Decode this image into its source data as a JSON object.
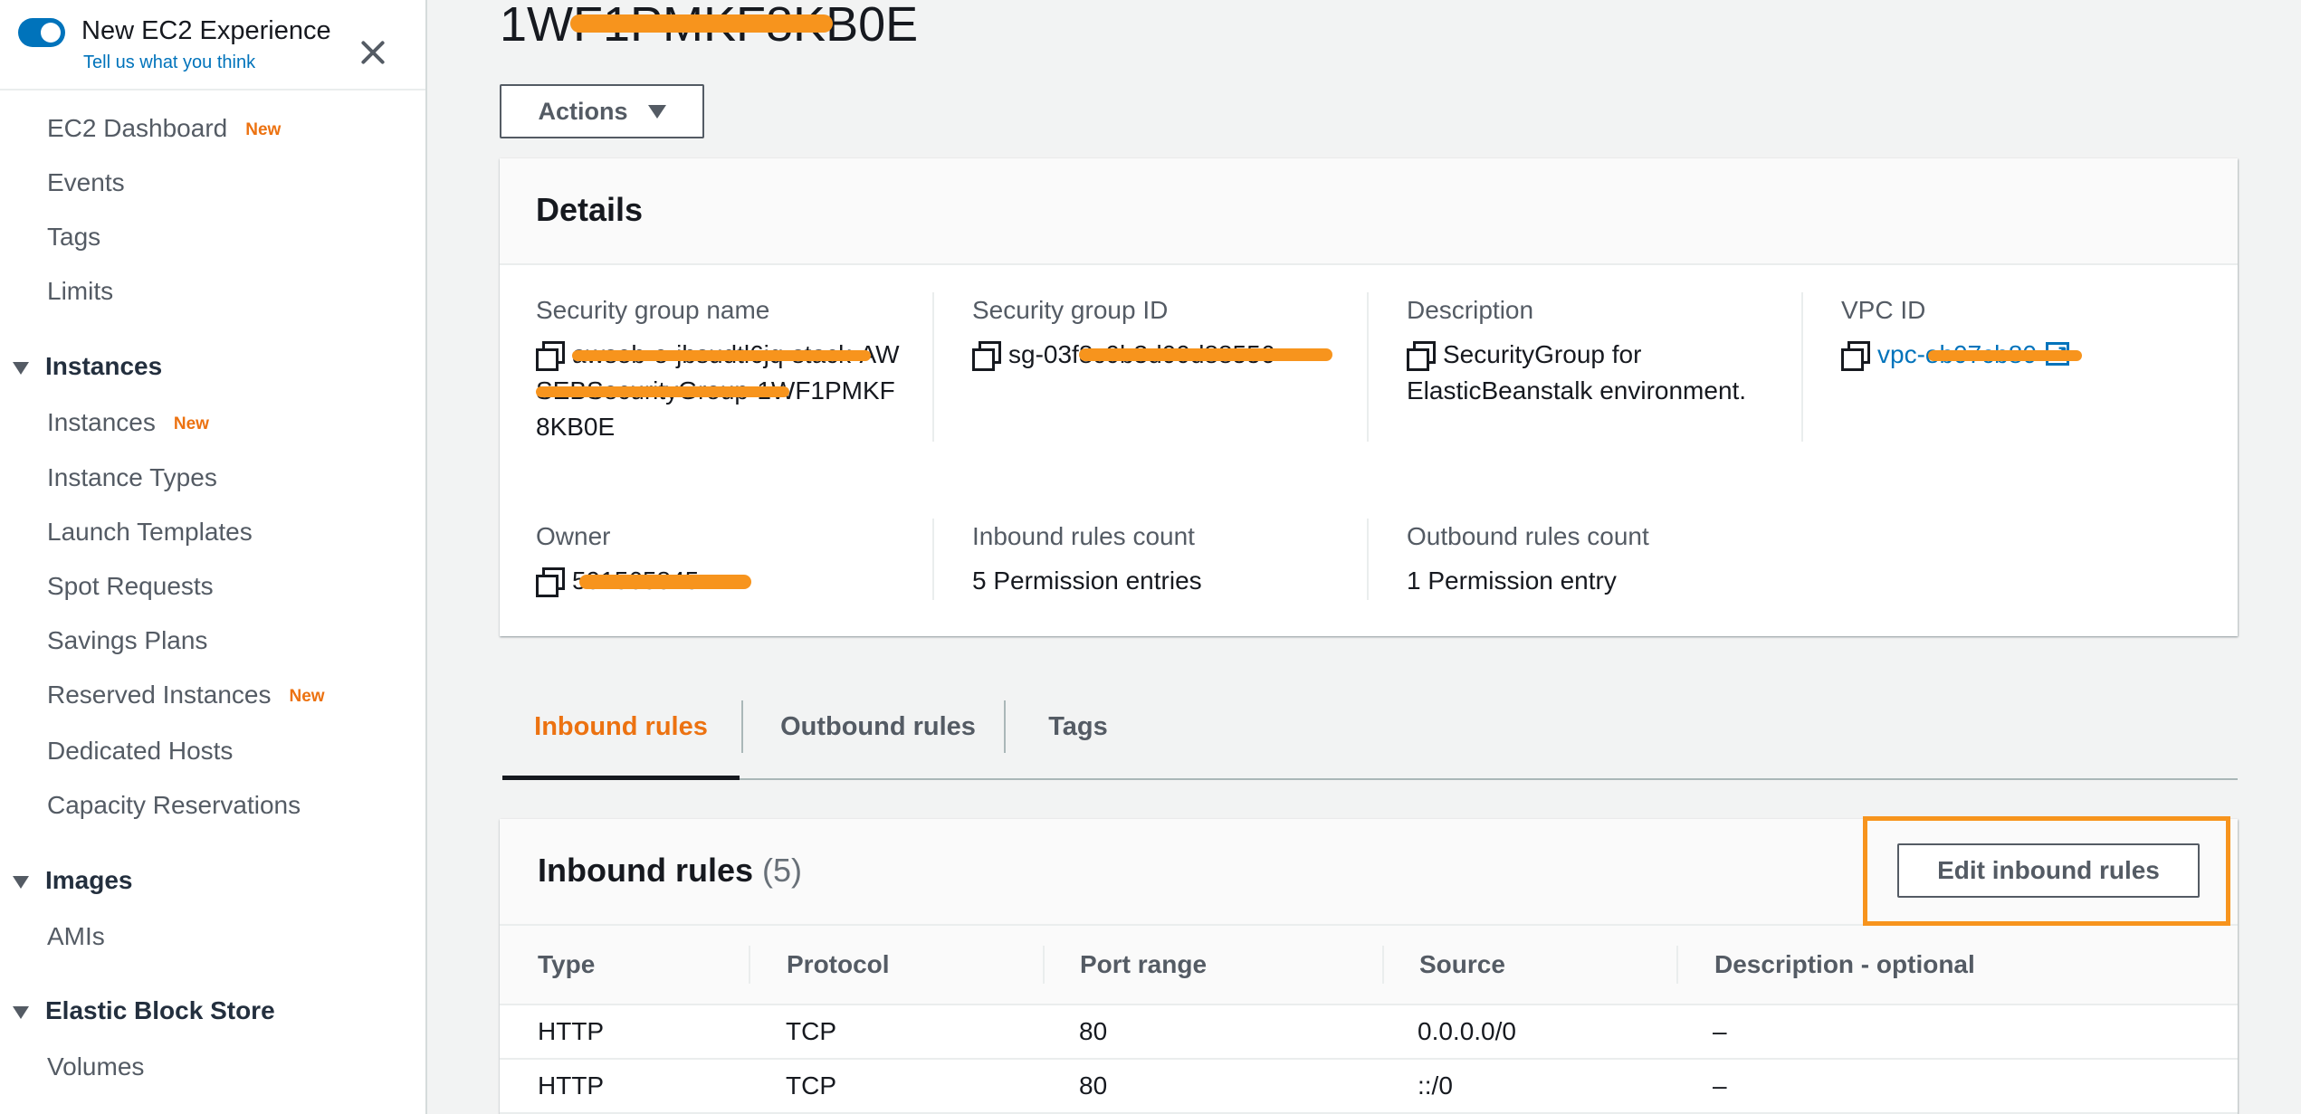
{
  "experience": {
    "title": "New EC2 Experience",
    "feedback_link": "Tell us what you think",
    "toggle_on": true
  },
  "sidebar": {
    "new_badge": "New",
    "items": [
      {
        "label": "EC2 Dashboard",
        "new": true
      },
      {
        "label": "Events"
      },
      {
        "label": "Tags"
      },
      {
        "label": "Limits"
      }
    ],
    "sections": [
      {
        "title": "Instances",
        "items": [
          {
            "label": "Instances",
            "new": true
          },
          {
            "label": "Instance Types"
          },
          {
            "label": "Launch Templates"
          },
          {
            "label": "Spot Requests"
          },
          {
            "label": "Savings Plans"
          },
          {
            "label": "Reserved Instances",
            "new": true
          },
          {
            "label": "Dedicated Hosts"
          },
          {
            "label": "Capacity Reservations"
          }
        ]
      },
      {
        "title": "Images",
        "items": [
          {
            "label": "AMIs"
          }
        ]
      },
      {
        "title": "Elastic Block Store",
        "items": [
          {
            "label": "Volumes"
          }
        ]
      }
    ]
  },
  "page": {
    "title": "1WF1PMKF8KB0E",
    "actions_label": "Actions"
  },
  "details": {
    "title": "Details",
    "sg_name_label": "Security group name",
    "sg_name_value": "awseb-e-jbsudtl6jq-stack-AWSEBSecurityGroup-1WF1PMKF8KB0E",
    "sg_id_label": "Security group ID",
    "sg_id_value": "sg-03f8c0b3d00d88556",
    "description_label": "Description",
    "description_value": "SecurityGroup for ElasticBeanstalk environment.",
    "vpc_label": "VPC ID",
    "vpc_value": "vpc-eb07cb80",
    "owner_label": "Owner",
    "owner_value": "591565845",
    "inbound_count_label": "Inbound rules count",
    "inbound_count_value": "5 Permission entries",
    "outbound_count_label": "Outbound rules count",
    "outbound_count_value": "1 Permission entry"
  },
  "tabs": [
    {
      "label": "Inbound rules",
      "active": true
    },
    {
      "label": "Outbound rules"
    },
    {
      "label": "Tags"
    }
  ],
  "inbound": {
    "title": "Inbound rules",
    "count": "(5)",
    "edit_label": "Edit inbound rules",
    "columns": [
      "Type",
      "Protocol",
      "Port range",
      "Source",
      "Description - optional"
    ],
    "rows": [
      [
        "HTTP",
        "TCP",
        "80",
        "0.0.0.0/0",
        "–"
      ],
      [
        "HTTP",
        "TCP",
        "80",
        "::/0",
        "–"
      ]
    ]
  },
  "colors": {
    "accent": "#ec7211",
    "link": "#0073bb",
    "highlight": "#f7941d"
  },
  "icons": [
    "toggle-switch-icon",
    "close-icon",
    "caret-down-icon",
    "copy-icon",
    "external-link-icon"
  ]
}
